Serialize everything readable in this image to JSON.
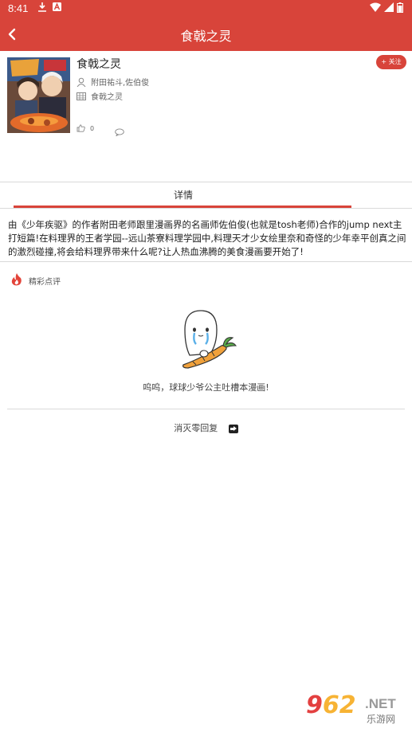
{
  "status_bar": {
    "time": "8:41"
  },
  "app_bar": {
    "title": "食戟之灵"
  },
  "comic": {
    "title": "食戟之灵",
    "authors": "附田祐斗,佐伯俊",
    "category": "食戟之灵",
    "follow_label": "+ 关注",
    "likes": "0"
  },
  "tabs": [
    {
      "label": "详情",
      "active": true
    }
  ],
  "description": "由《少年疾驱》的作者附田老师跟里漫画界的名画师佐伯俊(也就是tosh老师)合作的jump next主打短篇!在料理界的王者学园--远山茶寮料理学园中,料理天才少女绘里奈和奇怪的少年幸平创真之间的激烈碰撞,将会给料理界带来什么呢?让人热血沸腾的美食漫画要开始了!",
  "comments": {
    "section_label": "精彩点评",
    "empty_message": "呜呜，球球少爷公主吐槽本漫画!",
    "reply_label": "消灭零回复"
  },
  "watermark": {
    "brand_a": "9",
    "brand_b": "62",
    "net": ".NET",
    "site": "乐游网"
  },
  "colors": {
    "accent": "#d8443a",
    "divider": "#d9d9d9"
  }
}
